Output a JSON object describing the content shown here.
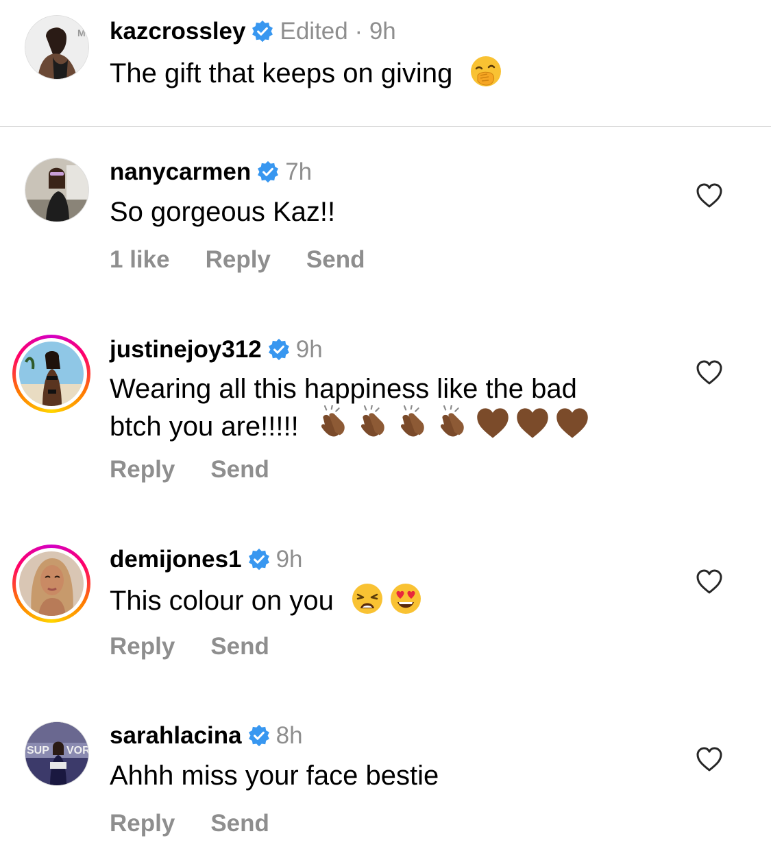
{
  "comments": [
    {
      "username": "kazcrossley",
      "meta": "Edited · 9h",
      "text": "The gift that keeps on giving",
      "emojis": [
        "face-with-hand-over-mouth"
      ]
    },
    {
      "username": "nanycarmen",
      "meta": "7h",
      "text": "So gorgeous Kaz!!",
      "likes": "1 like",
      "reply": "Reply",
      "send": "Send"
    },
    {
      "username": "justinejoy312",
      "meta": "9h",
      "text_line1": "Wearing all this happiness like the bad",
      "text_line2": "btch you are!!!!!",
      "emojis": [
        "clapping-hands-medium-dark",
        "clapping-hands-medium-dark",
        "clapping-hands-medium-dark",
        "clapping-hands-medium-dark",
        "brown-heart",
        "brown-heart",
        "brown-heart"
      ],
      "reply": "Reply",
      "send": "Send"
    },
    {
      "username": "demijones1",
      "meta": "9h",
      "text": "This colour on you",
      "emojis": [
        "weary-face",
        "smiling-face-with-heart-eyes"
      ],
      "reply": "Reply",
      "send": "Send"
    },
    {
      "username": "sarahlacina",
      "meta": "8h",
      "text": "Ahhh miss your face bestie",
      "reply": "Reply",
      "send": "Send"
    }
  ],
  "colors": {
    "verified": "#3897f0",
    "secondary_text": "#8e8e8e",
    "divider": "#dbdbdb",
    "story_ring": [
      "#d300c5",
      "#ff0069",
      "#ff7a00",
      "#ffd600"
    ]
  },
  "icons": {
    "verified": "verified-badge-icon",
    "like": "heart-outline-icon"
  }
}
